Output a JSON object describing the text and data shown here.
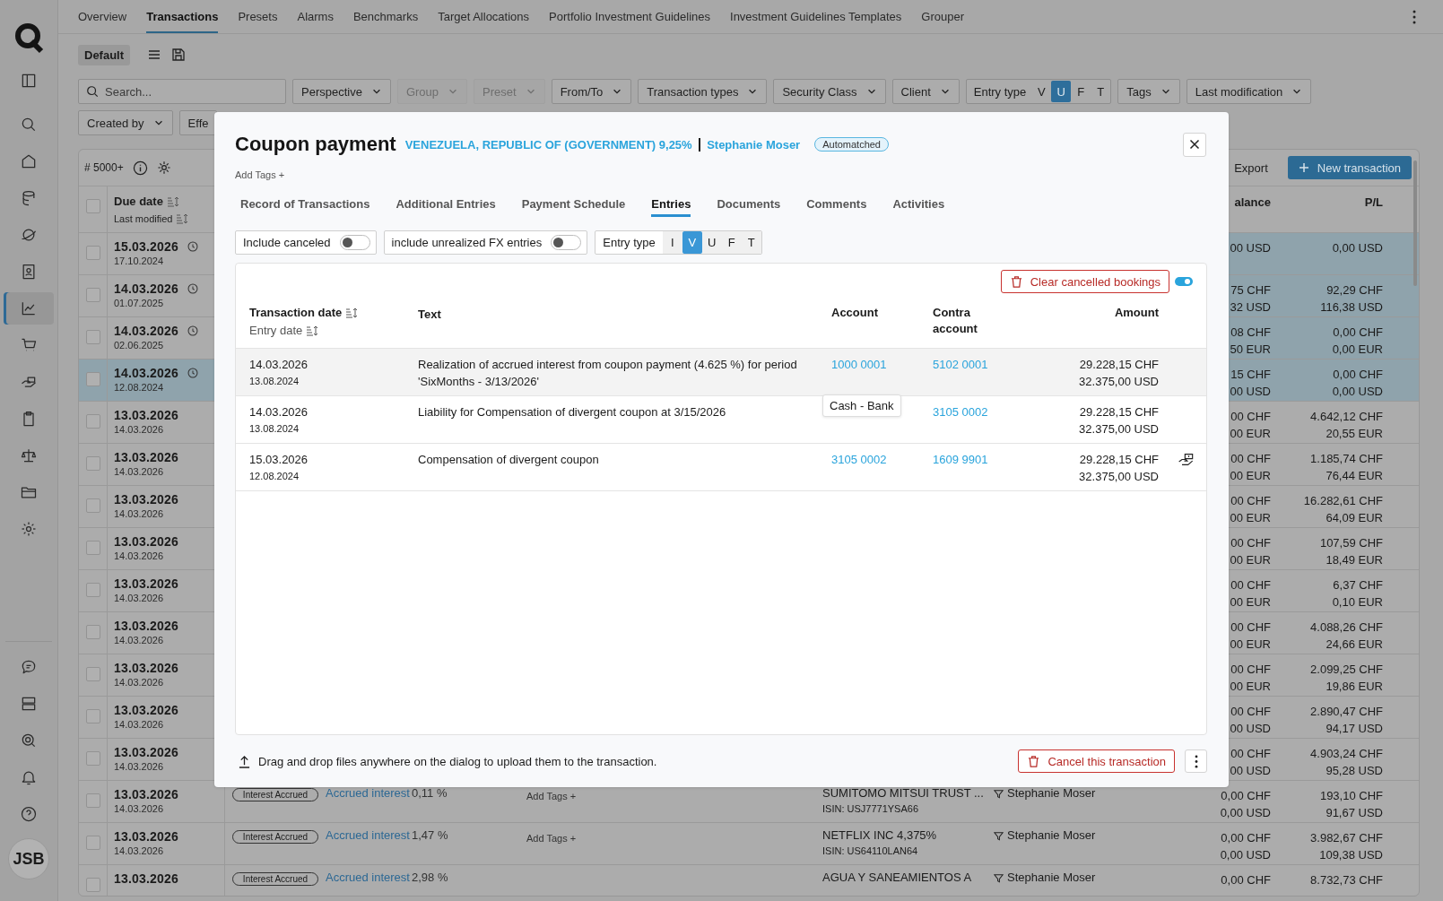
{
  "sidebar": {
    "items": [
      {
        "selected": false
      },
      {
        "selected": false
      },
      {
        "selected": false
      },
      {
        "selected": false
      },
      {
        "selected": false
      },
      {
        "selected": false
      },
      {
        "selected": true
      },
      {
        "selected": false
      },
      {
        "selected": false
      },
      {
        "selected": false
      },
      {
        "selected": false
      },
      {
        "selected": false
      },
      {
        "selected": false
      }
    ],
    "avatar": "JSB"
  },
  "nav": {
    "tabs": [
      {
        "label": "Overview",
        "selected": false
      },
      {
        "label": "Transactions",
        "selected": true
      },
      {
        "label": "Presets",
        "selected": false
      },
      {
        "label": "Alarms",
        "selected": false
      },
      {
        "label": "Benchmarks",
        "selected": false
      },
      {
        "label": "Target Allocations",
        "selected": false
      },
      {
        "label": "Portfolio Investment Guidelines",
        "selected": false
      },
      {
        "label": "Investment Guidelines Templates",
        "selected": false
      },
      {
        "label": "Grouper",
        "selected": false
      }
    ]
  },
  "toolbar": {
    "view": "Default"
  },
  "filters": {
    "search_placeholder": "Search...",
    "items": [
      {
        "kind": "dropdown",
        "label": "Perspective",
        "disabled": false
      },
      {
        "kind": "dropdown",
        "label": "Group",
        "disabled": true
      },
      {
        "kind": "dropdown",
        "label": "Preset",
        "disabled": true
      },
      {
        "kind": "dropdown",
        "label": "From/To",
        "disabled": false
      },
      {
        "kind": "dropdown",
        "label": "Transaction types",
        "disabled": false
      },
      {
        "kind": "dropdown",
        "label": "Security Class",
        "disabled": false
      },
      {
        "kind": "dropdown",
        "label": "Client",
        "disabled": false
      },
      {
        "kind": "segment",
        "label": "Entry type",
        "options": [
          {
            "label": "V",
            "selected": false
          },
          {
            "label": "U",
            "selected": true
          },
          {
            "label": "F",
            "selected": false
          },
          {
            "label": "T",
            "selected": false
          }
        ]
      },
      {
        "kind": "dropdown",
        "label": "Tags",
        "disabled": false
      },
      {
        "kind": "dropdown",
        "label": "Last modification",
        "disabled": false
      }
    ],
    "second_row": [
      {
        "kind": "dropdown",
        "label": "Created by",
        "disabled": false
      },
      {
        "kind": "cut",
        "label": "Effe"
      }
    ]
  },
  "table": {
    "select_all_checked": false,
    "count": "# 5000+",
    "export": "Export",
    "new_button": "New transaction",
    "due_header": "Due date",
    "modified_header": "Last modified",
    "balance_header": "alance",
    "pl_header": "P/L",
    "rows": [
      {
        "due": "15.03.2026",
        "modified": "17.10.2024",
        "pending": true,
        "marked": true,
        "selected": false,
        "balance": [
          "00 USD"
        ],
        "pl": [
          "0,00 USD"
        ]
      },
      {
        "due": "14.03.2026",
        "modified": "01.07.2025",
        "pending": true,
        "marked": true,
        "selected": false,
        "balance": [
          "75 CHF",
          "32 USD"
        ],
        "pl": [
          "92,29 CHF",
          "116,38 USD"
        ]
      },
      {
        "due": "14.03.2026",
        "modified": "02.06.2025",
        "pending": true,
        "marked": true,
        "selected": false,
        "balance": [
          "08 CHF",
          "50 EUR"
        ],
        "pl": [
          "0,00 CHF",
          "0,00 EUR"
        ]
      },
      {
        "due": "14.03.2026",
        "modified": "12.08.2024",
        "pending": true,
        "marked": true,
        "selected": true,
        "balance": [
          "15 CHF",
          "00 USD"
        ],
        "pl": [
          "0,00 CHF",
          "0,00 USD"
        ]
      },
      {
        "due": "13.03.2026",
        "modified": "14.03.2026",
        "pending": false,
        "marked": false,
        "selected": false,
        "balance": [
          "00 CHF",
          "00 EUR"
        ],
        "pl": [
          "4.642,12 CHF",
          "20,55 EUR"
        ]
      },
      {
        "due": "13.03.2026",
        "modified": "14.03.2026",
        "pending": false,
        "marked": false,
        "selected": false,
        "balance": [
          "00 CHF",
          "00 EUR"
        ],
        "pl": [
          "1.185,74 CHF",
          "76,44 EUR"
        ]
      },
      {
        "due": "13.03.2026",
        "modified": "14.03.2026",
        "pending": false,
        "marked": false,
        "selected": false,
        "balance": [
          "00 CHF",
          "00 EUR"
        ],
        "pl": [
          "16.282,61 CHF",
          "64,09 EUR"
        ]
      },
      {
        "due": "13.03.2026",
        "modified": "14.03.2026",
        "pending": false,
        "marked": false,
        "selected": false,
        "balance": [
          "00 CHF",
          "00 EUR"
        ],
        "pl": [
          "107,59 CHF",
          "18,49 EUR"
        ]
      },
      {
        "due": "13.03.2026",
        "modified": "14.03.2026",
        "pending": false,
        "marked": false,
        "selected": false,
        "balance": [
          "00 CHF",
          "00 EUR"
        ],
        "pl": [
          "6,37 CHF",
          "0,10 EUR"
        ]
      },
      {
        "due": "13.03.2026",
        "modified": "14.03.2026",
        "pending": false,
        "marked": false,
        "selected": false,
        "balance": [
          "00 CHF",
          "00 EUR"
        ],
        "pl": [
          "4.088,26 CHF",
          "24,66 EUR"
        ]
      },
      {
        "due": "13.03.2026",
        "modified": "14.03.2026",
        "pending": false,
        "marked": false,
        "selected": false,
        "balance": [
          "00 CHF",
          "00 EUR"
        ],
        "pl": [
          "2.099,25 CHF",
          "19,86 EUR"
        ]
      },
      {
        "due": "13.03.2026",
        "modified": "14.03.2026",
        "pending": false,
        "marked": false,
        "selected": false,
        "balance": [
          "00 CHF",
          "00 USD"
        ],
        "pl": [
          "2.890,47 CHF",
          "94,17 USD"
        ]
      },
      {
        "due": "13.03.2026",
        "modified": "14.03.2026",
        "pending": false,
        "marked": false,
        "selected": false,
        "balance": [
          "00 CHF",
          "00 USD"
        ],
        "pl": [
          "4.903,24 CHF",
          "95,28 USD"
        ]
      },
      {
        "due": "13.03.2026",
        "modified": "14.03.2026",
        "pending": false,
        "marked": false,
        "selected": false,
        "details": {
          "tag": "Interest Accrued",
          "link": "Accrued interest",
          "rate": "0,11 %",
          "add_tags": "Add Tags +",
          "security": "SUMITOMO MITSUI TRUST ...",
          "isin": "ISIN: USJ7771YSA66",
          "client": "Stephanie Moser"
        },
        "balance": [
          "0,00 CHF",
          "0,00 USD"
        ],
        "pl": [
          "193,10 CHF",
          "91,67 USD"
        ]
      },
      {
        "due": "13.03.2026",
        "modified": "14.03.2026",
        "pending": false,
        "marked": false,
        "selected": false,
        "details": {
          "tag": "Interest Accrued",
          "link": "Accrued interest",
          "rate": "1,47 %",
          "add_tags": "Add Tags +",
          "security": "NETFLIX INC 4,375%",
          "isin": "ISIN: US64110LAN64",
          "client": "Stephanie Moser"
        },
        "balance": [
          "0,00 CHF",
          "0,00 USD"
        ],
        "pl": [
          "3.982,67 CHF",
          "109,38 USD"
        ]
      },
      {
        "due": "13.03.2026",
        "pending": false,
        "marked": false,
        "selected": false,
        "details": {
          "tag": "Interest Accrued",
          "link": "Accrued interest",
          "rate": "2,98 %",
          "security": "AGUA Y SANEAMIENTOS A",
          "client": "Stephanie Moser"
        },
        "balance": [
          "0,00 CHF"
        ],
        "pl": [
          "8.732,73 CHF"
        ]
      }
    ]
  },
  "dialog": {
    "title": "Coupon payment",
    "security": "VENEZUELA, REPUBLIC OF (GOVERNMENT) 9,25%",
    "separator": "|",
    "client": "Stephanie Moser",
    "status": "Automatched",
    "add_tags": "Add Tags +",
    "tabs": [
      {
        "label": "Record of Transactions",
        "selected": false
      },
      {
        "label": "Additional Entries",
        "selected": false
      },
      {
        "label": "Payment Schedule",
        "selected": false
      },
      {
        "label": "Entries",
        "selected": true
      },
      {
        "label": "Documents",
        "selected": false
      },
      {
        "label": "Comments",
        "selected": false
      },
      {
        "label": "Activities",
        "selected": false
      }
    ],
    "toggles": [
      {
        "label": "Include canceled",
        "on": false
      },
      {
        "label": "include unrealized FX entries",
        "on": false
      }
    ],
    "entry_type": {
      "label": "Entry type",
      "options": [
        {
          "label": "I",
          "selected": false
        },
        {
          "label": "V",
          "selected": true
        },
        {
          "label": "U",
          "selected": false
        },
        {
          "label": "F",
          "selected": false
        },
        {
          "label": "T",
          "selected": false
        }
      ]
    },
    "clear_button": "Clear cancelled bookings",
    "clear_toggle_on": true,
    "columns": {
      "date": "Transaction date",
      "entry_date": "Entry date",
      "text": "Text",
      "account": "Account",
      "contra": "Contra account",
      "amount": "Amount"
    },
    "entries": [
      {
        "date": "14.03.2026",
        "entry_date": "13.08.2024",
        "text": "Realization of accrued interest from coupon payment (4.625 %) for period 'SixMonths - 3/13/2026'",
        "account": "1000 0001",
        "contra": "5102 0001",
        "amounts": [
          "29.228,15 CHF",
          "32.375,00 USD"
        ],
        "selected": true,
        "flagged": false,
        "tooltip": "Cash - Bank"
      },
      {
        "date": "14.03.2026",
        "entry_date": "13.08.2024",
        "text": "Liability for Compensation of divergent coupon at 3/15/2026",
        "contra": "3105 0002",
        "amounts": [
          "29.228,15 CHF",
          "32.375,00 USD"
        ],
        "selected": false,
        "flagged": false
      },
      {
        "date": "15.03.2026",
        "entry_date": "12.08.2024",
        "text": "Compensation of divergent coupon",
        "account": "3105 0002",
        "contra": "1609 9901",
        "amounts": [
          "29.228,15 CHF",
          "32.375,00 USD"
        ],
        "selected": false,
        "flagged": true
      }
    ],
    "upload_hint": "Drag and drop files anywhere on the dialog to upload them to the transaction.",
    "cancel_button": "Cancel this transaction"
  }
}
